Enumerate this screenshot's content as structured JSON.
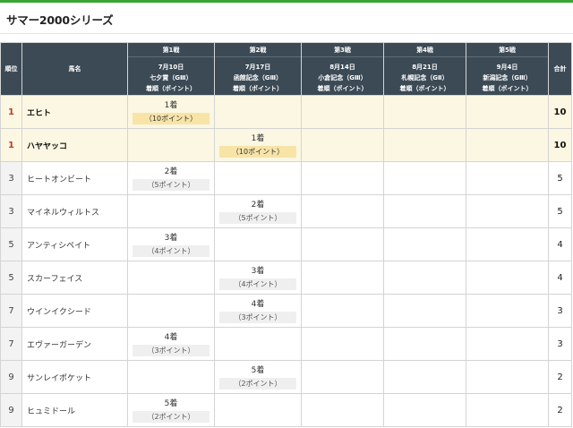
{
  "page": {
    "title": "サマー2000シリーズ"
  },
  "header": {
    "rank": "順位",
    "horse": "馬名",
    "total": "合計",
    "races": [
      {
        "no": "第1戦",
        "date": "7月10日",
        "name": "七夕賞（GⅢ）",
        "criteria": "着順（ポイント）"
      },
      {
        "no": "第2戦",
        "date": "7月17日",
        "name": "函館記念（GⅢ）",
        "criteria": "着順（ポイント）"
      },
      {
        "no": "第3戦",
        "date": "8月14日",
        "name": "小倉記念（GⅢ）",
        "criteria": "着順（ポイント）"
      },
      {
        "no": "第4戦",
        "date": "8月21日",
        "name": "札幌記念（GⅡ）",
        "criteria": "着順（ポイント）"
      },
      {
        "no": "第5戦",
        "date": "9月4日",
        "name": "新潟記念（GⅢ）",
        "criteria": "着順（ポイント）"
      }
    ]
  },
  "rows": [
    {
      "rank": "1",
      "horse": "エヒト",
      "total": "10",
      "results": [
        {
          "place": "1着",
          "points": "（10ポイント）"
        },
        null,
        null,
        null,
        null
      ]
    },
    {
      "rank": "1",
      "horse": "ハヤヤッコ",
      "total": "10",
      "results": [
        null,
        {
          "place": "1着",
          "points": "（10ポイント）"
        },
        null,
        null,
        null
      ]
    },
    {
      "rank": "3",
      "horse": "ヒートオンビート",
      "total": "5",
      "results": [
        {
          "place": "2着",
          "points": "（5ポイント）"
        },
        null,
        null,
        null,
        null
      ]
    },
    {
      "rank": "3",
      "horse": "マイネルウィルトス",
      "total": "5",
      "results": [
        null,
        {
          "place": "2着",
          "points": "（5ポイント）"
        },
        null,
        null,
        null
      ]
    },
    {
      "rank": "5",
      "horse": "アンティシペイト",
      "total": "4",
      "results": [
        {
          "place": "3着",
          "points": "（4ポイント）"
        },
        null,
        null,
        null,
        null
      ]
    },
    {
      "rank": "5",
      "horse": "スカーフェイス",
      "total": "4",
      "results": [
        null,
        {
          "place": "3着",
          "points": "（4ポイント）"
        },
        null,
        null,
        null
      ]
    },
    {
      "rank": "7",
      "horse": "ウインイクシード",
      "total": "3",
      "results": [
        null,
        {
          "place": "4着",
          "points": "（3ポイント）"
        },
        null,
        null,
        null
      ]
    },
    {
      "rank": "7",
      "horse": "エヴァーガーデン",
      "total": "3",
      "results": [
        {
          "place": "4着",
          "points": "（3ポイント）"
        },
        null,
        null,
        null,
        null
      ]
    },
    {
      "rank": "9",
      "horse": "サンレイポケット",
      "total": "2",
      "results": [
        null,
        {
          "place": "5着",
          "points": "（2ポイント）"
        },
        null,
        null,
        null
      ]
    },
    {
      "rank": "9",
      "horse": "ヒュミドール",
      "total": "2",
      "results": [
        {
          "place": "5着",
          "points": "（2ポイント）"
        },
        null,
        null,
        null,
        null
      ]
    }
  ],
  "colors": {
    "accent": "#3aa535",
    "header_bg": "#3b4a55",
    "leader_row_bg": "#fbf7e2",
    "leader_points_bg": "#f8e4a7",
    "leader_rank": "#c0392b"
  }
}
